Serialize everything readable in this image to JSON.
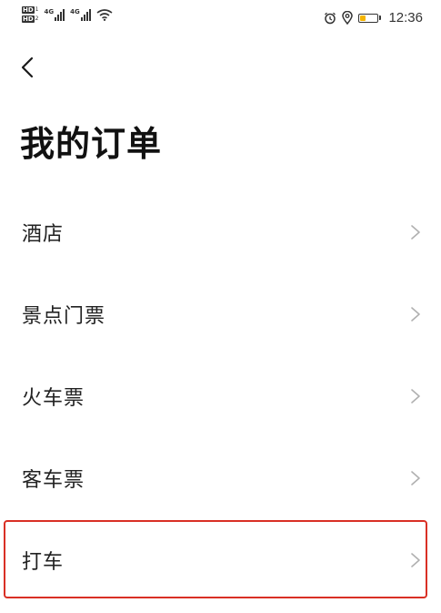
{
  "status_bar": {
    "hd_label_1": "HD",
    "hd_sub_1": "1",
    "hd_label_2": "HD",
    "hd_sub_2": "2",
    "network_1": "4G",
    "network_2": "4G",
    "time": "12:36",
    "battery_level": 0.35,
    "battery_color": "#f5b400",
    "icons": [
      "hd-icon",
      "signal-icon",
      "wifi-icon",
      "alarm-icon",
      "location-icon",
      "battery-icon"
    ]
  },
  "header": {
    "back_icon": "chevron-left-icon",
    "title": "我的订单"
  },
  "orders": {
    "items": [
      {
        "label": "酒店"
      },
      {
        "label": "景点门票"
      },
      {
        "label": "火车票"
      },
      {
        "label": "客车票"
      },
      {
        "label": "打车"
      }
    ],
    "chevron_icon": "chevron-right-icon"
  },
  "highlight": {
    "target": "打车",
    "color": "#d93025"
  }
}
